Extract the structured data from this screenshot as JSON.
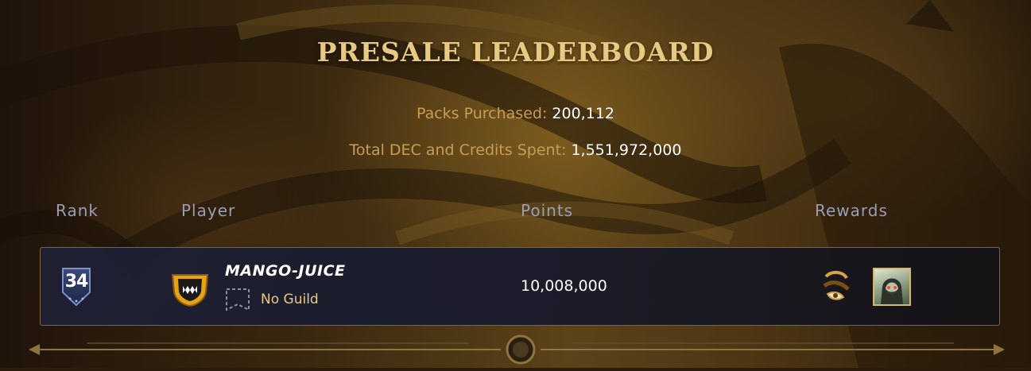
{
  "title": "PRESALE LEADERBOARD",
  "stats": {
    "packs_label": "Packs Purchased:",
    "packs_value": "200,112",
    "spent_label": "Total DEC and Credits Spent:",
    "spent_value": "1,551,972,000"
  },
  "columns": {
    "rank": "Rank",
    "player": "Player",
    "points": "Points",
    "rewards": "Rewards"
  },
  "rows": [
    {
      "rank": "34",
      "player_name": "MANGO-JUICE",
      "guild": "No Guild",
      "points": "10,008,000",
      "emblem_icon": "fanged-monster-shield-icon",
      "rewards": [
        "scroll-reward-icon",
        "hooded-character-card-icon"
      ]
    }
  ],
  "colors": {
    "title_gold": "#e8c983",
    "label_gold": "#c79d58",
    "header_gray": "#9a9db4",
    "row_border": "#7c6638",
    "row_bg": "#1e2034"
  }
}
